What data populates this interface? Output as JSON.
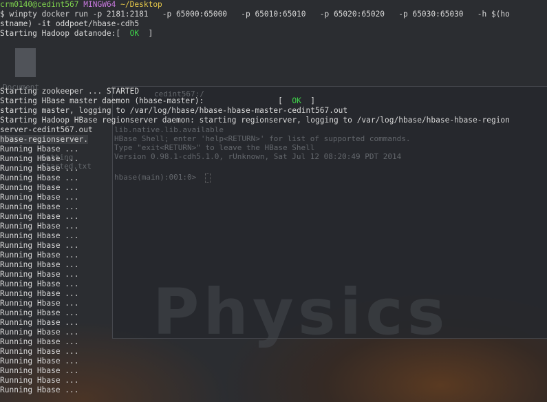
{
  "background": {
    "desktop_file_label": "Document",
    "ghost_title": "cedint567:/",
    "ghost_lines": [
      "lib.native.lib.available",
      "HBase Shell; enter 'help<RETURN>' for list of supported commands.",
      "Type \"exit<RETURN>\" to leave the HBase Shell",
      "Version 0.98.1-cdh5.1.0, rUnknown, Sat Jul 12 08:20:49 PDT 2014",
      "",
      "hbase(main):001:0>"
    ],
    "ghost_shortcut_label": "Getting Started.txt",
    "wallpaper_word": "Physics"
  },
  "terminal": {
    "prompt": {
      "user_host": "crm0140@cedint567",
      "env": "MINGW64",
      "path": "~/Desktop"
    },
    "command_line_1": "$ winpty docker run -p 2181:2181   -p 65000:65000   -p 65010:65010   -p 65020:65020   -p 65030:65030   -h $(ho",
    "command_line_2": "stname) -it oddpoet/hbase-cdh5",
    "datanode_prefix": "Starting Hadoop datanode:[  ",
    "ok_label": "OK",
    "datanode_suffix": "  ]",
    "zookeeper_line": "Starting zookeeper ... STARTED",
    "master_prefix": "Starting HBase master daemon (hbase-master):                [  ",
    "master_suffix": "  ]",
    "master_logging": "starting master, logging to /var/log/hbase/hbase-hbase-master-cedint567.out",
    "regionserver_line_1": "Starting Hadoop HBase regionserver daemon: starting regionserver, logging to /var/log/hbase/hbase-hbase-region",
    "regionserver_line_2": "server-cedint567.out",
    "regionserver_line_3": "hbase-regionserver.",
    "running_lines": [
      "Running Hbase ...",
      "Running Hbase ...",
      "Running Hbase ...",
      "Running Hbase ...",
      "Running Hbase ...",
      "Running Hbase ...",
      "Running Hbase ...",
      "Running Hbase ...",
      "Running Hbase ...",
      "Running Hbase ...",
      "Running Hbase ...",
      "Running Hbase ...",
      "Running Hbase ...",
      "Running Hbase ...",
      "Running Hbase ...",
      "Running Hbase ...",
      "Running Hbase ...",
      "Running Hbase ...",
      "Running Hbase ...",
      "Running Hbase ...",
      "Running Hbase ...",
      "Running Hbase ...",
      "Running Hbase ...",
      "Running Hbase ...",
      "Running Hbase ...",
      "Running Hbase ..."
    ]
  }
}
